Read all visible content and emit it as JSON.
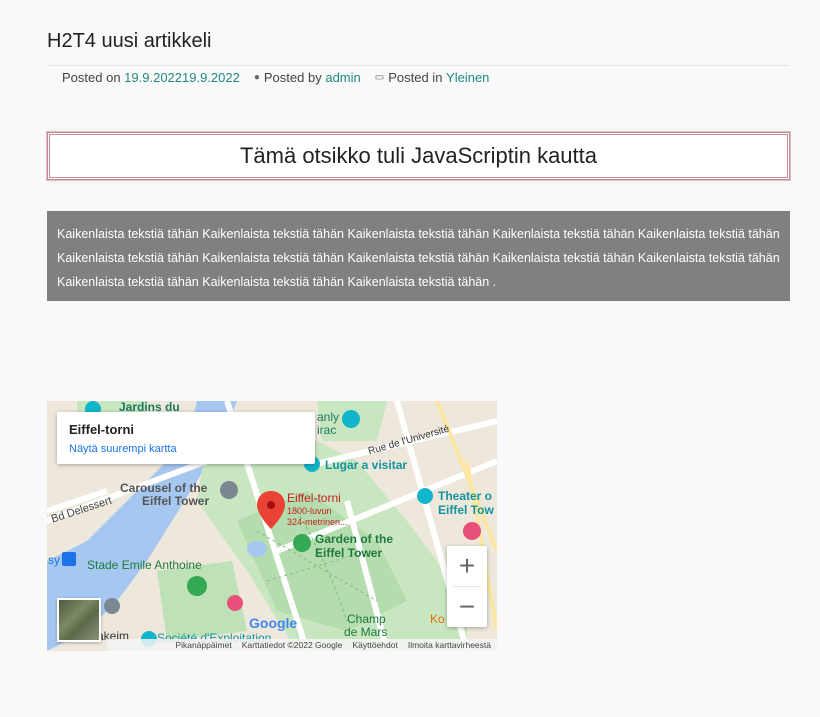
{
  "post": {
    "title": "H2T4 uusi artikkeli",
    "posted_on_label": "Posted on",
    "date": "19.9.202219.9.2022",
    "posted_by_label": "Posted by",
    "author": "admin",
    "posted_in_label": "Posted in",
    "category": "Yleinen"
  },
  "js_heading": "Tämä otsikko tuli JavaScriptin kautta",
  "gray_text": "Kaikenlaista tekstiä tähän Kaikenlaista tekstiä tähän Kaikenlaista tekstiä tähän Kaikenlaista tekstiä tähän Kaikenlaista tekstiä tähän Kaikenlaista tekstiä tähän Kaikenlaista tekstiä tähän Kaikenlaista tekstiä tähän Kaikenlaista tekstiä tähän Kaikenlaista tekstiä tähän Kaikenlaista tekstiä tähän Kaikenlaista tekstiä tähän Kaikenlaista tekstiä tähän .",
  "map": {
    "info_title": "Eiffel-torni",
    "info_link": "Näytä suurempi kartta",
    "labels": {
      "jardins": "Jardins du",
      "branly": "anly",
      "irac": "irac",
      "universite": "Rue de l'Université",
      "lugar": "Lugar a visitar",
      "carousel1": "Carousel of the",
      "carousel2": "Eiffel Tower",
      "bd_delessert": "Bd Delessert",
      "eiffel_torni": "Eiffel-torni",
      "eiffel_sub1": "1800-luvun",
      "eiffel_sub2": "324-metrinen...",
      "theater1": "Theater o",
      "theater2": "Eiffel Tow",
      "garden1": "Garden of the",
      "garden2": "Eiffel Tower",
      "stade": "Stade Emile Anthoine",
      "sy": "sy",
      "champ1": "Champ",
      "champ2": "de Mars",
      "kor": "Ko",
      "akeim": "akeim",
      "societe": "Société d'Exploitation",
      "google": "Google"
    },
    "zoom_in": "+",
    "zoom_out": "−",
    "attribution": [
      "Pikanäppäimet",
      "Karttatiedot ©2022 Google",
      "Käyttöehdot",
      "Ilmoita karttavirheestä"
    ]
  },
  "colors": {
    "link": "#1e8a82",
    "gray_box": "#808080",
    "heading_border": "#c98a98",
    "marker": "#ea4335"
  }
}
